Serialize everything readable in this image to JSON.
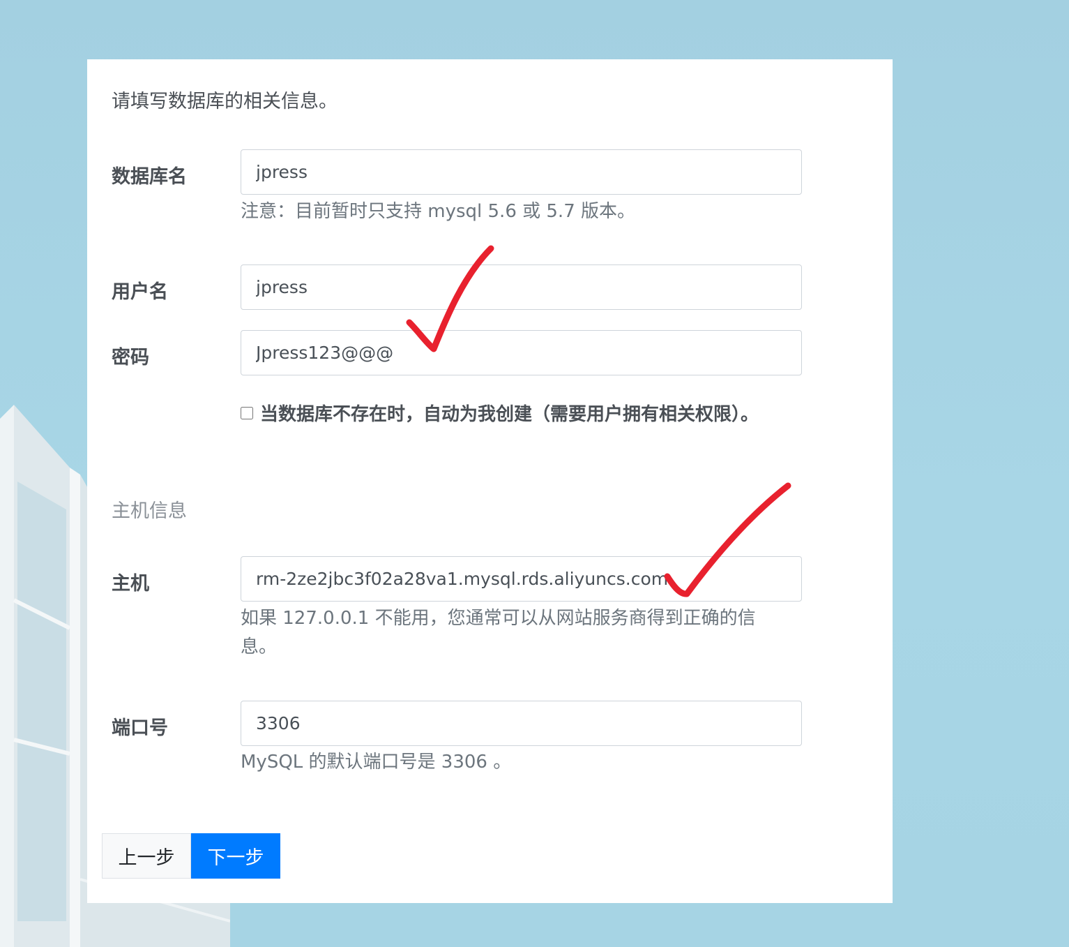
{
  "form": {
    "intro": "请填写数据库的相关信息。",
    "db_name": {
      "label": "数据库名",
      "value": "jpress",
      "hint": "注意：目前暂时只支持 mysql 5.6 或 5.7 版本。"
    },
    "username": {
      "label": "用户名",
      "value": "jpress"
    },
    "password": {
      "label": "密码",
      "value": "Jpress123@@@"
    },
    "auto_create": {
      "label": "当数据库不存在时，自动为我创建（需要用户拥有相关权限）。",
      "checked": false
    },
    "host_section": {
      "title": "主机信息"
    },
    "host": {
      "label": "主机",
      "value": "rm-2ze2jbc3f02a28va1.mysql.rds.aliyuncs.com",
      "hint": "如果 127.0.0.1 不能用，您通常可以从网站服务商得到正确的信息。"
    },
    "port": {
      "label": "端口号",
      "value": "3306",
      "hint": "MySQL 的默认端口号是 3306 。"
    }
  },
  "buttons": {
    "prev_label": "上一步",
    "next_label": "下一步"
  },
  "colors": {
    "primary": "#007bff",
    "annotation": "#e8212e"
  },
  "annotations": {
    "marks": [
      "checkmark",
      "checkmark"
    ]
  }
}
